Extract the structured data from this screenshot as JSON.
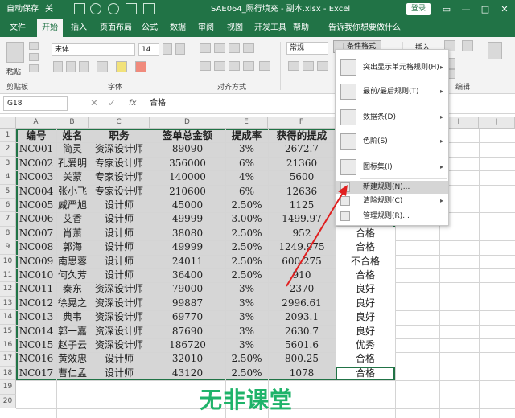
{
  "app": {
    "autosave": "自动保存",
    "autosave_state": "关",
    "title": "SAE064_隔行填充 - 副本.xlsx  -  Excel",
    "login": "登录",
    "accent": "#217346"
  },
  "tabs": [
    "文件",
    "开始",
    "插入",
    "页面布局",
    "公式",
    "数据",
    "审阅",
    "视图",
    "开发工具",
    "帮助"
  ],
  "active_tab": "开始",
  "tell_me": "告诉我你想要做什么",
  "ribbon": {
    "paste": "粘贴",
    "font_name": "宋体",
    "font_size": "14",
    "number_format": "常规",
    "insert": "插入",
    "cond_format": "条件格式",
    "group_clipboard": "剪贴板",
    "group_font": "字体",
    "group_align": "对齐方式",
    "group_edit": "编辑"
  },
  "formula_bar": {
    "namebox": "G18",
    "fx": "fx",
    "value": "合格"
  },
  "columns": [
    "A",
    "B",
    "C",
    "D",
    "E",
    "F",
    "G",
    "H",
    "I",
    "J"
  ],
  "rows": [
    "1",
    "2",
    "3",
    "4",
    "5",
    "6",
    "7",
    "8",
    "9",
    "10",
    "11",
    "12",
    "13",
    "14",
    "15",
    "16",
    "17",
    "18",
    "19",
    "20"
  ],
  "table": {
    "headers": [
      "编号",
      "姓名",
      "职务",
      "签单总金额",
      "提成率",
      "获得的提成"
    ],
    "rows": [
      [
        "NC001",
        "简灵",
        "资深设计师",
        "89090",
        "3%",
        "2672.7"
      ],
      [
        "NC002",
        "孔爱明",
        "专家设计师",
        "356000",
        "6%",
        "21360"
      ],
      [
        "NC003",
        "关蒙",
        "专家设计师",
        "140000",
        "4%",
        "5600"
      ],
      [
        "NC004",
        "张小飞",
        "专家设计师",
        "210600",
        "6%",
        "12636"
      ],
      [
        "NC005",
        "威严旭",
        "设计师",
        "45000",
        "2.50%",
        "1125"
      ],
      [
        "NC006",
        "艾香",
        "设计师",
        "49999",
        "3.00%",
        "1499.97"
      ],
      [
        "NC007",
        "肖萧",
        "设计师",
        "38080",
        "2.50%",
        "952"
      ],
      [
        "NC008",
        "郭海",
        "设计师",
        "49999",
        "2.50%",
        "1249.975"
      ],
      [
        "NC009",
        "南思蓉",
        "设计师",
        "24011",
        "2.50%",
        "600.275"
      ],
      [
        "NC010",
        "何久芳",
        "设计师",
        "36400",
        "2.50%",
        "910"
      ],
      [
        "NC011",
        "秦东",
        "资深设计师",
        "79000",
        "3%",
        "2370"
      ],
      [
        "NC012",
        "徐晃之",
        "资深设计师",
        "99887",
        "3%",
        "2996.61"
      ],
      [
        "NC013",
        "典韦",
        "资深设计师",
        "69770",
        "3%",
        "2093.1"
      ],
      [
        "NC014",
        "郭一嘉",
        "资深设计师",
        "87690",
        "3%",
        "2630.7"
      ],
      [
        "NC015",
        "赵子云",
        "资深设计师",
        "186720",
        "3%",
        "5601.6"
      ],
      [
        "NC016",
        "黄效忠",
        "设计师",
        "32010",
        "2.50%",
        "800.25"
      ],
      [
        "NC017",
        "曹仁孟",
        "设计师",
        "43120",
        "2.50%",
        "1078"
      ]
    ],
    "evaluation_visible": [
      "",
      "",
      "",
      "",
      "",
      "",
      "合格",
      "合格",
      "不合格",
      "合格",
      "良好",
      "良好",
      "良好",
      "良好",
      "优秀",
      "合格",
      "合格"
    ]
  },
  "menu": {
    "items": [
      {
        "label": "突出显示单元格规则(H)",
        "icon": "highlight-rules-icon",
        "submenu": true
      },
      {
        "label": "最前/最后规则(T)",
        "icon": "top-bottom-rules-icon",
        "submenu": true
      },
      {
        "label": "数据条(D)",
        "icon": "data-bars-icon",
        "submenu": true
      },
      {
        "label": "色阶(S)",
        "icon": "color-scales-icon",
        "submenu": true
      },
      {
        "label": "图标集(I)",
        "icon": "icon-sets-icon",
        "submenu": true
      },
      {
        "label": "新建规则(N)...",
        "icon": "new-rule-icon",
        "submenu": false
      },
      {
        "label": "清除规则(C)",
        "icon": "clear-rules-icon",
        "submenu": true
      },
      {
        "label": "管理规则(R)...",
        "icon": "manage-rules-icon",
        "submenu": false
      }
    ],
    "highlighted": "新建规则(N)..."
  },
  "watermark": "无非课堂"
}
